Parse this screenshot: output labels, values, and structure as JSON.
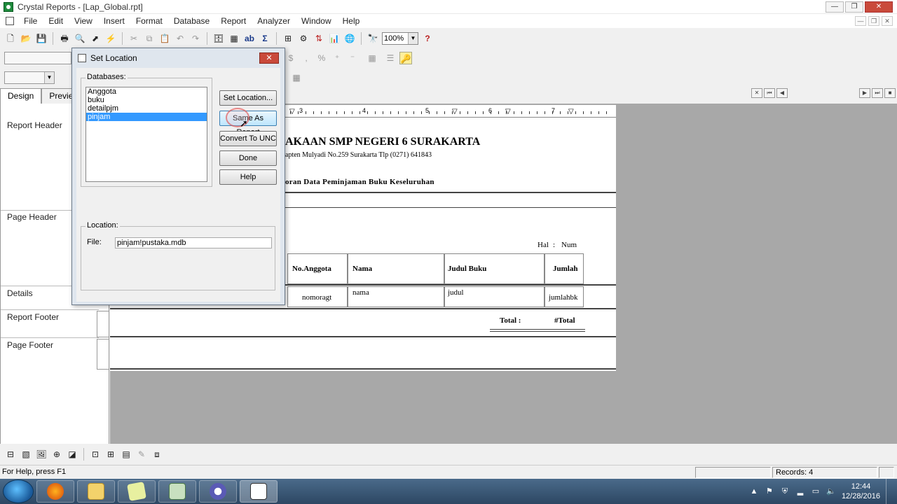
{
  "window": {
    "title": "Crystal Reports - [Lap_Global.rpt]"
  },
  "menu": [
    "File",
    "Edit",
    "View",
    "Insert",
    "Format",
    "Database",
    "Report",
    "Analyzer",
    "Window",
    "Help"
  ],
  "toolbar": {
    "zoom": "100%",
    "ab_label": "ab"
  },
  "tabs": {
    "design": "Design",
    "preview": "Preview"
  },
  "sections": {
    "report_header": "Report Header",
    "page_header": "Page Header",
    "details": "Details",
    "report_footer": "Report Footer",
    "page_footer": "Page Footer"
  },
  "ruler": [
    "3",
    "4",
    "5",
    "6",
    "7"
  ],
  "report": {
    "title": "AKAAN SMP NEGERI 6 SURAKARTA",
    "address": "apten Mulyadi No.259  Surakarta Tlp (0271) 641843",
    "subtitle": "oran Data Peminjaman Buku Keseluruhan",
    "page_label": "Hal",
    "page_sep": ":",
    "page_field": "Num",
    "col_no_anggota": "No.Anggota",
    "col_nama": "Nama",
    "col_judul": "Judul Buku",
    "col_jumlah": "Jumlah",
    "fld_nomoragt": "nomoragt",
    "fld_nama": "nama",
    "fld_judul": "judul",
    "fld_jumlah": "jumlahbk",
    "total_label": "Total  :",
    "total_field": "#Total"
  },
  "dialog": {
    "title": "Set Location",
    "databases_label": "Databases:",
    "databases": [
      "Anggota",
      "buku",
      "detailpjm",
      "pinjam"
    ],
    "selected_database": "pinjam",
    "buttons": {
      "set_location": "Set Location...",
      "same_as_report": "Same As Report",
      "convert_unc": "Convert To UNC",
      "done": "Done",
      "help": "Help"
    },
    "location_label": "Location:",
    "file_label": "File:",
    "file_value": "pinjam!pustaka.mdb"
  },
  "status": {
    "help": "For Help, press F1",
    "records": "Records: 4"
  },
  "taskbar": {
    "time": "12:44",
    "date": "12/28/2016"
  },
  "colors": {
    "selection": "#3399ff",
    "close_red": "#c94a3b",
    "taskbar": "#2d4763"
  }
}
